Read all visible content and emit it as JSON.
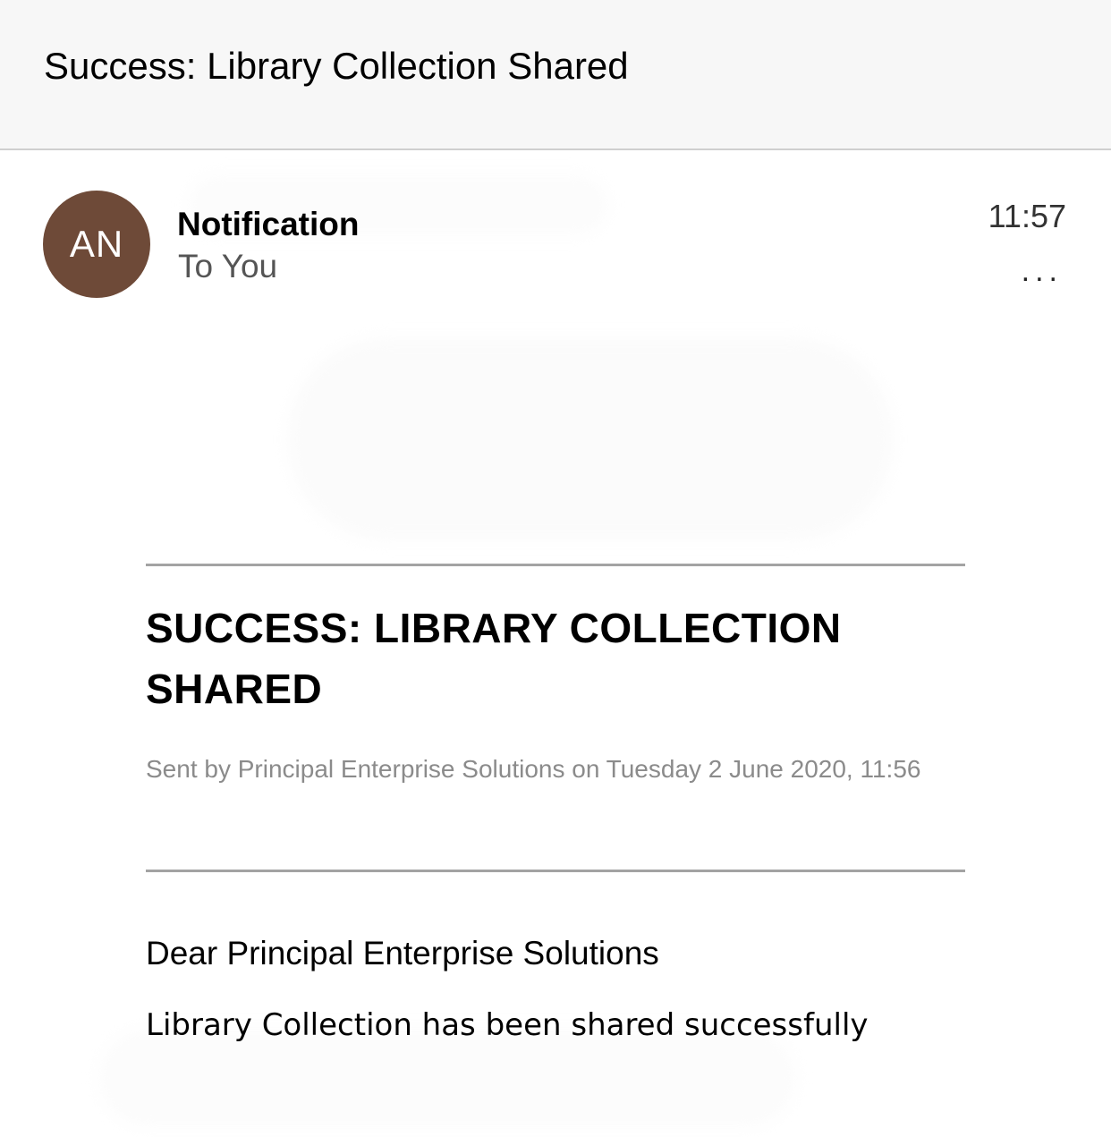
{
  "header": {
    "subject": "Success: Library Collection Shared"
  },
  "message_meta": {
    "avatar_initials": "AN",
    "avatar_color": "#6e4a38",
    "sender": "Notification",
    "recipient": "To You",
    "time": "11:57",
    "more_icon": "ellipsis-icon",
    "more_glyph": "..."
  },
  "email_body": {
    "title": "SUCCESS: LIBRARY COLLECTION SHARED",
    "sent_line": "Sent by Principal Enterprise Solutions on Tuesday 2 June 2020, 11:56",
    "greeting": "Dear Principal Enterprise Solutions",
    "message": "Library Collection has been shared successfully"
  }
}
